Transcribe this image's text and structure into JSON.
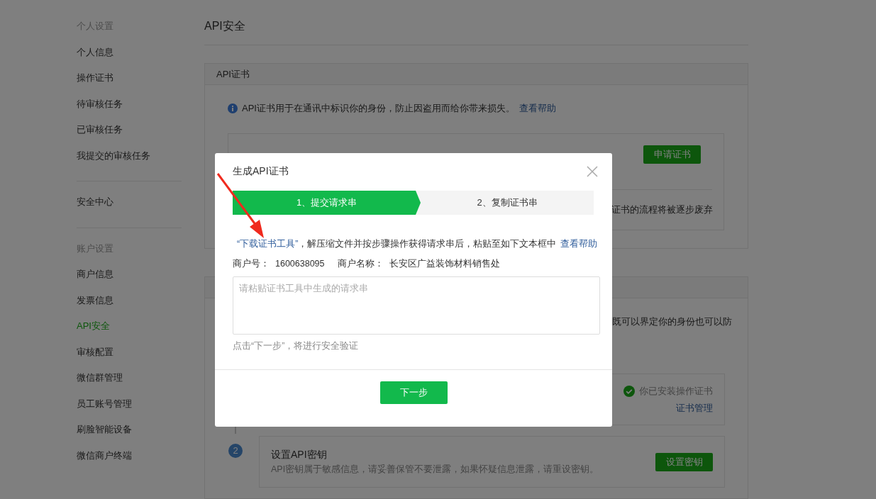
{
  "sidebar": {
    "groups": [
      {
        "heading": "个人设置",
        "items": [
          {
            "label": "个人信息",
            "selected": false
          },
          {
            "label": "操作证书",
            "selected": false
          },
          {
            "label": "待审核任务",
            "selected": false
          },
          {
            "label": "已审核任务",
            "selected": false
          },
          {
            "label": "我提交的审核任务",
            "selected": false
          }
        ]
      },
      {
        "items": [
          {
            "label": "安全中心",
            "selected": false
          }
        ]
      },
      {
        "heading": "账户设置",
        "items": [
          {
            "label": "商户信息",
            "selected": false
          },
          {
            "label": "发票信息",
            "selected": false
          },
          {
            "label": "API安全",
            "selected": true
          },
          {
            "label": "审核配置",
            "selected": false
          },
          {
            "label": "微信群管理",
            "selected": false
          },
          {
            "label": "员工账号管理",
            "selected": false
          },
          {
            "label": "刷脸智能设备",
            "selected": false
          },
          {
            "label": "微信商户终端",
            "selected": false
          }
        ]
      }
    ]
  },
  "page": {
    "title": "API安全",
    "cert_panel": {
      "header": "API证书",
      "info": "API证书用于在通讯中标识你的身份，防止因盗用而给你带来损失。",
      "help_link": "查看帮助",
      "apply_card": {
        "button": "申请证书",
        "note": "证书的流程将被逐步废弃"
      }
    },
    "key_panel": {
      "info": "既可以界定你的身份也可以防",
      "steps": [
        {
          "kind": "status",
          "status": "你已安装操作证书",
          "link": "证书管理"
        },
        {
          "kind": "action",
          "number": "2",
          "title": "设置API密钥",
          "description": "API密钥属于敏感信息，请妥善保管不要泄露，如果怀疑信息泄露，请重设密钥。",
          "button": "设置密钥"
        }
      ]
    }
  },
  "modal": {
    "title": "生成API证书",
    "steps": [
      {
        "label": "1、提交请求串",
        "selected": true
      },
      {
        "label": "2、复制证书串",
        "selected": false
      }
    ],
    "info_link": "“下载证书工具”",
    "info": "，解压缩文件并按步骤操作获得请求串后，粘贴至如下文本框中",
    "help_link": "查看帮助",
    "merchant_id_label": "商户号：",
    "merchant_id": "1600638095",
    "merchant_name_label": "商户名称：",
    "merchant_name": "长安区广益装饰材料销售处",
    "placeholder": "请粘贴证书工具中生成的请求串",
    "hint": "点击“下一步”，将进行安全验证",
    "button": "下一步"
  }
}
